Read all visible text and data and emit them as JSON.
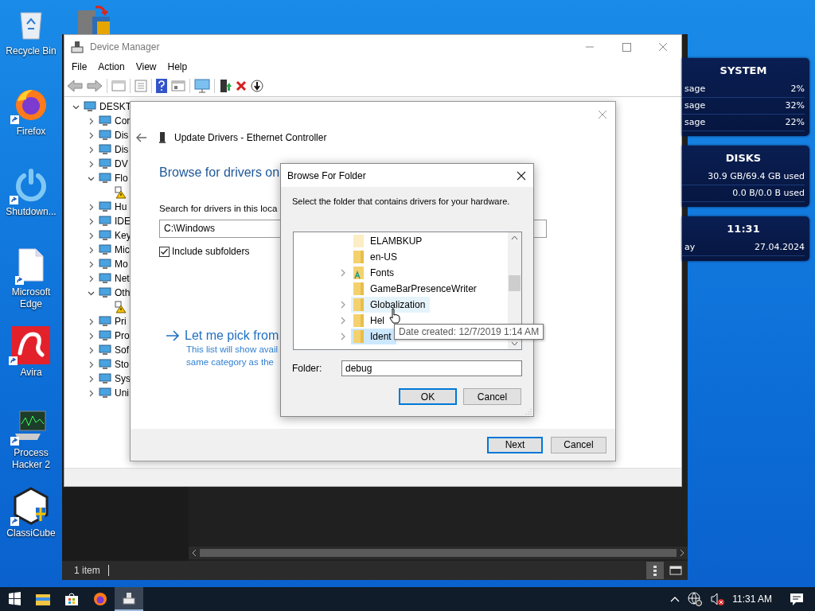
{
  "desktop_icons": [
    {
      "label": "Recycle Bin",
      "kind": "recycle",
      "shortcut": false
    },
    {
      "label": "Firefox",
      "kind": "firefox",
      "shortcut": true
    },
    {
      "label": "Shutdown...",
      "kind": "power",
      "shortcut": true
    },
    {
      "label": "Microsoft Edge",
      "kind": "file",
      "shortcut": true
    },
    {
      "label": "Avira",
      "kind": "avira",
      "shortcut": true
    },
    {
      "label": "Process Hacker 2",
      "kind": "monitor",
      "shortcut": true
    },
    {
      "label": "ClassiCube",
      "kind": "cube",
      "shortcut": true
    }
  ],
  "widget": {
    "panels": [
      {
        "title": "SYSTEM",
        "rows": [
          {
            "label": "sage",
            "value": "2%"
          },
          {
            "label": "sage",
            "value": "32%"
          },
          {
            "label": "sage",
            "value": "22%"
          }
        ]
      },
      {
        "title": "DISKS",
        "rows": [
          {
            "value": "30.9 GB/69.4 GB used"
          },
          {
            "value": "0.0 B/0.0 B used"
          }
        ]
      },
      {
        "title": "11:31",
        "rows": [
          {
            "label": "ay",
            "value": "27.04.2024"
          }
        ]
      }
    ]
  },
  "explorer": {
    "status": "1 item"
  },
  "device_manager": {
    "title": "Device Manager",
    "menu": [
      "File",
      "Action",
      "View",
      "Help"
    ],
    "tree": {
      "label": "DESKT",
      "expanded": true,
      "children": [
        {
          "label": "Cor",
          "expanded": false
        },
        {
          "label": "Dis",
          "expanded": false
        },
        {
          "label": "Dis",
          "expanded": false
        },
        {
          "label": "DV",
          "expanded": false
        },
        {
          "label": "Flo",
          "expanded": true,
          "children": [
            {
              "warning": true
            }
          ]
        },
        {
          "label": "Hu",
          "expanded": false
        },
        {
          "label": "IDE",
          "expanded": false
        },
        {
          "label": "Key",
          "expanded": false
        },
        {
          "label": "Mic",
          "expanded": false
        },
        {
          "label": "Mo",
          "expanded": false
        },
        {
          "label": "Net",
          "expanded": false
        },
        {
          "label": "Oth",
          "expanded": true,
          "children": [
            {
              "warning": true
            }
          ]
        },
        {
          "label": "Pri",
          "expanded": false
        },
        {
          "label": "Pro",
          "expanded": false
        },
        {
          "label": "Sof",
          "expanded": false
        },
        {
          "label": "Sto",
          "expanded": false
        },
        {
          "label": "Sys",
          "expanded": false
        },
        {
          "label": "Uni",
          "expanded": false
        }
      ]
    }
  },
  "update_drivers": {
    "title": "Update Drivers - Ethernet Controller",
    "heading": "Browse for drivers on",
    "search_label": "Search for drivers in this loca",
    "path": "C:\\Windows",
    "include_subfolders": {
      "label": "Include subfolders",
      "checked": true
    },
    "pick_link": "Let me pick from",
    "pick_note": [
      "This list will show avail",
      "same category as the"
    ],
    "buttons": [
      {
        "label": "Next",
        "default": true
      },
      {
        "label": "Cancel",
        "default": false
      }
    ]
  },
  "browse_dialog": {
    "title": "Browse For Folder",
    "prompt": "Select the folder that contains drivers for your hardware.",
    "folders": [
      {
        "name": "ELAMBKUP",
        "kind": "hidden",
        "expandable": false,
        "hovered": false,
        "selected": false
      },
      {
        "name": "en-US",
        "kind": "folder",
        "expandable": false,
        "hovered": false,
        "selected": false
      },
      {
        "name": "Fonts",
        "kind": "fonts",
        "expandable": true,
        "hovered": false,
        "selected": false
      },
      {
        "name": "GameBarPresenceWriter",
        "kind": "folder",
        "expandable": false,
        "hovered": false,
        "selected": false
      },
      {
        "name": "Globalization",
        "kind": "folder",
        "expandable": true,
        "hovered": true,
        "selected": false
      },
      {
        "name": "Hel",
        "kind": "folder",
        "expandable": true,
        "hovered": false,
        "selected": false
      },
      {
        "name": "Ident",
        "kind": "folder",
        "expandable": true,
        "hovered": false,
        "selected": true
      }
    ],
    "tooltip": "Date created: 12/7/2019 1:14 AM",
    "folder_label": "Folder:",
    "folder_value": "debug",
    "buttons": [
      {
        "label": "OK",
        "default": true
      },
      {
        "label": "Cancel",
        "default": false
      }
    ]
  },
  "taskbar": {
    "apps": [
      {
        "kind": "explorer",
        "active": false
      },
      {
        "kind": "store",
        "active": false
      },
      {
        "kind": "firefox",
        "active": false
      },
      {
        "kind": "devmgr",
        "active": true
      }
    ],
    "time": "11:31 AM"
  }
}
